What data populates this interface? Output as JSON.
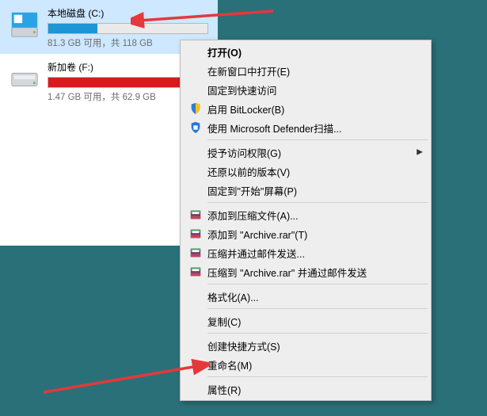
{
  "drives": [
    {
      "name": "本地磁盘 (C:)",
      "stats": "81.3 GB 可用，共 118 GB",
      "fill_pct": 31,
      "fill_color": "#1e95d4",
      "selected": true,
      "is_system": true
    },
    {
      "name": "新加卷 (F:)",
      "stats": "1.47 GB 可用，共 62.9 GB",
      "fill_pct": 97,
      "fill_color": "#d61a1d",
      "selected": false,
      "is_system": false
    }
  ],
  "menu": [
    {
      "type": "item",
      "label": "打开(O)",
      "bold": true,
      "icon": null,
      "submenu": false
    },
    {
      "type": "item",
      "label": "在新窗口中打开(E)",
      "icon": null,
      "submenu": false
    },
    {
      "type": "item",
      "label": "固定到快速访问",
      "icon": null,
      "submenu": false
    },
    {
      "type": "item",
      "label": "启用 BitLocker(B)",
      "icon": "shield-blue",
      "submenu": false
    },
    {
      "type": "item",
      "label": "使用 Microsoft Defender扫描...",
      "icon": "shield-defender",
      "submenu": false
    },
    {
      "type": "sep"
    },
    {
      "type": "item",
      "label": "授予访问权限(G)",
      "icon": null,
      "submenu": true
    },
    {
      "type": "item",
      "label": "还原以前的版本(V)",
      "icon": null,
      "submenu": false
    },
    {
      "type": "item",
      "label": "固定到\"开始\"屏幕(P)",
      "icon": null,
      "submenu": false
    },
    {
      "type": "sep"
    },
    {
      "type": "item",
      "label": "添加到压缩文件(A)...",
      "icon": "winrar",
      "submenu": false
    },
    {
      "type": "item",
      "label": "添加到 \"Archive.rar\"(T)",
      "icon": "winrar",
      "submenu": false
    },
    {
      "type": "item",
      "label": "压缩并通过邮件发送...",
      "icon": "winrar",
      "submenu": false
    },
    {
      "type": "item",
      "label": "压缩到 \"Archive.rar\" 并通过邮件发送",
      "icon": "winrar",
      "submenu": false
    },
    {
      "type": "sep"
    },
    {
      "type": "item",
      "label": "格式化(A)...",
      "icon": null,
      "submenu": false
    },
    {
      "type": "sep"
    },
    {
      "type": "item",
      "label": "复制(C)",
      "icon": null,
      "submenu": false
    },
    {
      "type": "sep"
    },
    {
      "type": "item",
      "label": "创建快捷方式(S)",
      "icon": null,
      "submenu": false
    },
    {
      "type": "item",
      "label": "重命名(M)",
      "icon": null,
      "submenu": false
    },
    {
      "type": "sep"
    },
    {
      "type": "item",
      "label": "属性(R)",
      "icon": null,
      "submenu": false
    }
  ],
  "accent": {
    "arrow_color": "#e5383a"
  }
}
